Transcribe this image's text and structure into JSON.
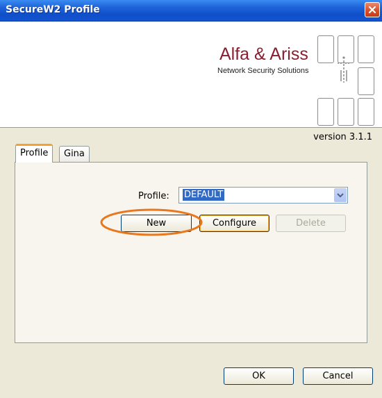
{
  "window": {
    "title": "SecureW2 Profile",
    "close_icon": "close-icon"
  },
  "banner": {
    "brand_name": "Alfa & Ariss",
    "brand_tagline": "Network Security Solutions"
  },
  "version": "version 3.1.1",
  "tabs": [
    {
      "label": "Profile",
      "selected": true
    },
    {
      "label": "Gina",
      "selected": false
    }
  ],
  "profile": {
    "label": "Profile:",
    "selected_value": "DEFAULT",
    "dropdown_icon": "chevron-down-icon"
  },
  "buttons": {
    "new": "New",
    "configure": "Configure",
    "delete": "Delete",
    "ok": "OK",
    "cancel": "Cancel"
  },
  "colors": {
    "titlebar": "#0f4fc9",
    "brand": "#8b1f2f",
    "selection": "#316ac5",
    "highlight_ring": "#e8781e"
  }
}
